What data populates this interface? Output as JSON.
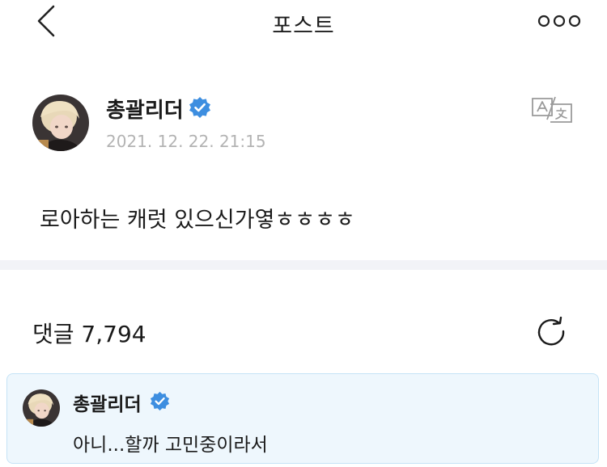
{
  "header": {
    "title": "포스트",
    "back_icon": "chevron-left-icon",
    "more_icon": "more-dots-icon"
  },
  "post": {
    "author_name": "총괄리더",
    "verified": true,
    "timestamp": "2021. 12. 22. 21:15",
    "body": "로아하는 캐럿 있으신가옇ㅎㅎㅎㅎ",
    "translate_icon": "translate-icon"
  },
  "comments": {
    "label": "댓글 7,794",
    "refresh_icon": "refresh-icon",
    "items": [
      {
        "author_name": "총괄리더",
        "verified": true,
        "text": "아니...할까 고민중이라서"
      }
    ]
  },
  "colors": {
    "verified_badge": "#3d8ee0",
    "timestamp": "#b3b3b3",
    "divider": "#f2f3f7",
    "comment_card_bg": "#eef7fd",
    "comment_card_border": "#c5e3f6"
  }
}
